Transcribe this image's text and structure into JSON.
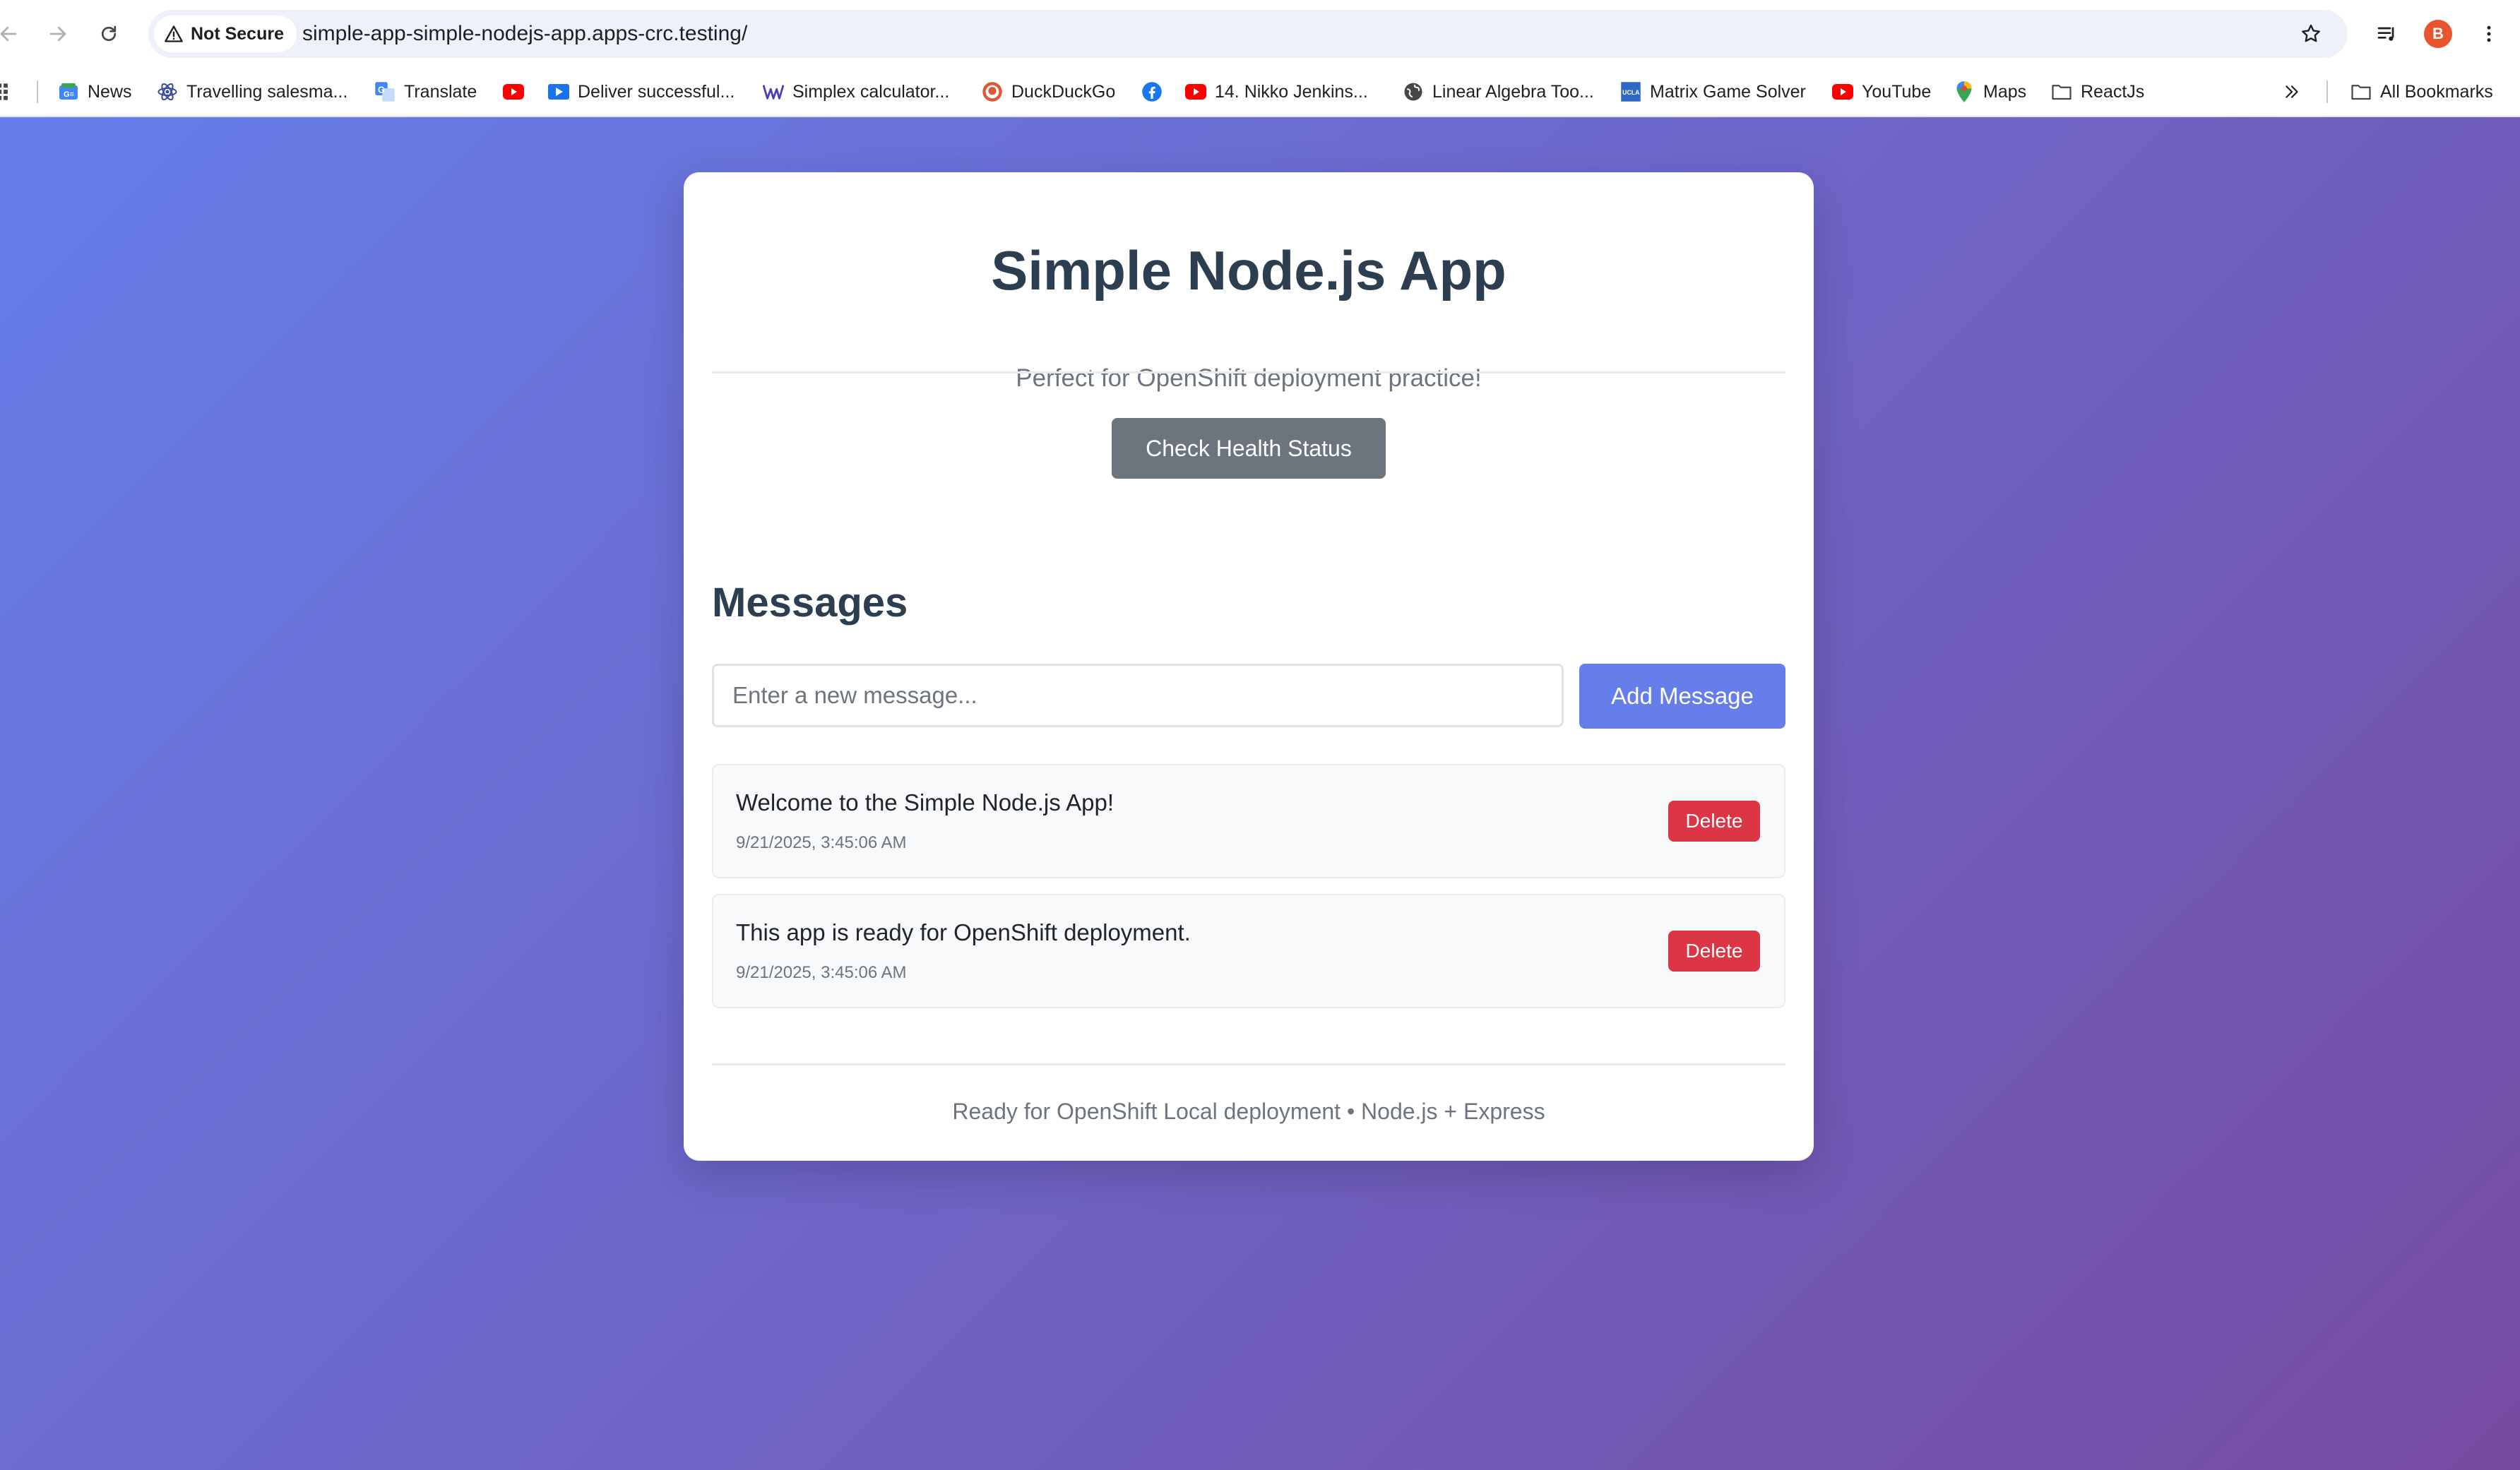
{
  "browser": {
    "security_label": "Not Secure",
    "url": "simple-app-simple-nodejs-app.apps-crc.testing/",
    "profile_initial": "B",
    "bookmarks": [
      {
        "label": "News",
        "icon": "google-news-icon"
      },
      {
        "label": "Travelling salesma...",
        "icon": "atom-icon"
      },
      {
        "label": "Translate",
        "icon": "google-translate-icon"
      },
      {
        "label": "",
        "icon": "youtube-icon"
      },
      {
        "label": "Deliver successful...",
        "icon": "video-play-icon"
      },
      {
        "label": "Simplex calculator...",
        "icon": "w-logo-icon"
      },
      {
        "label": "DuckDuckGo",
        "icon": "duckduckgo-icon"
      },
      {
        "label": "",
        "icon": "facebook-icon"
      },
      {
        "label": "14. Nikko Jenkins...",
        "icon": "youtube-icon"
      },
      {
        "label": "Linear Algebra Too...",
        "icon": "globe-icon"
      },
      {
        "label": "Matrix Game Solver",
        "icon": "ucla-icon"
      },
      {
        "label": "YouTube",
        "icon": "youtube-icon"
      },
      {
        "label": "Maps",
        "icon": "maps-pin-icon"
      },
      {
        "label": "ReactJs",
        "icon": "folder-icon"
      }
    ],
    "all_bookmarks_label": "All Bookmarks"
  },
  "app": {
    "title": "Simple Node.js App",
    "subtitle": "Perfect for OpenShift deployment practice!",
    "health_button": "Check Health Status",
    "messages_heading": "Messages",
    "input_placeholder": "Enter a new message...",
    "input_value": "",
    "add_button": "Add Message",
    "delete_label": "Delete",
    "messages": [
      {
        "text": "Welcome to the Simple Node.js App!",
        "timestamp": "9/21/2025, 3:45:06 AM"
      },
      {
        "text": "This app is ready for OpenShift deployment.",
        "timestamp": "9/21/2025, 3:45:06 AM"
      }
    ],
    "footer": "Ready for OpenShift Local deployment • Node.js + Express"
  },
  "colors": {
    "gradient_start": "#667eea",
    "gradient_end": "#764ba2",
    "primary": "#667eea",
    "secondary": "#6c757d",
    "danger": "#dc3545",
    "heading": "#2c3e50"
  }
}
